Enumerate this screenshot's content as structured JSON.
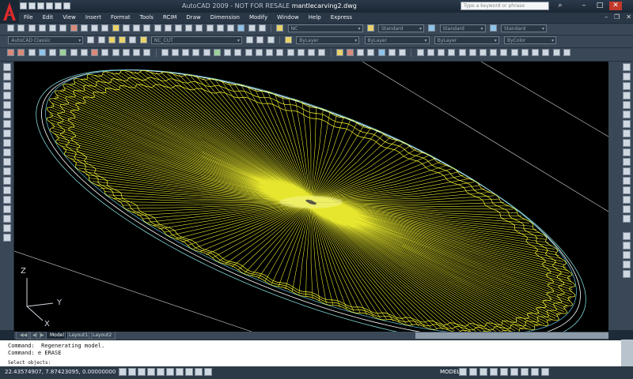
{
  "window": {
    "app_title": "AutoCAD 2009 - NOT FOR RESALE",
    "file_name": "mantlecarving2.dwg",
    "search_placeholder": "Type a keyword or phrase"
  },
  "menu": [
    "File",
    "Edit",
    "View",
    "Insert",
    "Format",
    "Tools",
    "RCIM",
    "Draw",
    "Dimension",
    "Modify",
    "Window",
    "Help",
    "Express"
  ],
  "toolbars": {
    "workspace": "AutoCAD Classic",
    "layer": "NC_CUT",
    "text_style": "NC",
    "dim_style": "Standard",
    "table_style": "Standard",
    "multileader_style": "Standard",
    "color": "ByLayer",
    "linetype": "ByLayer",
    "lineweight": "ByLayer",
    "plot_style": "ByColor"
  },
  "ucs": {
    "z": "Z",
    "y": "Y",
    "x": "X"
  },
  "layout_tabs": [
    "Model",
    "Layout1",
    "Layout2"
  ],
  "command_history": [
    "Command:  Regenerating model.",
    "Command: e ERASE"
  ],
  "command_prompt": "Select objects:",
  "status": {
    "coordinates": "22.43574907, 7.87423095, 0.00000000",
    "space": "MODEL"
  },
  "colors": {
    "wireframe": "#ffff33",
    "background": "#000000",
    "chrome": "#2a3746"
  }
}
